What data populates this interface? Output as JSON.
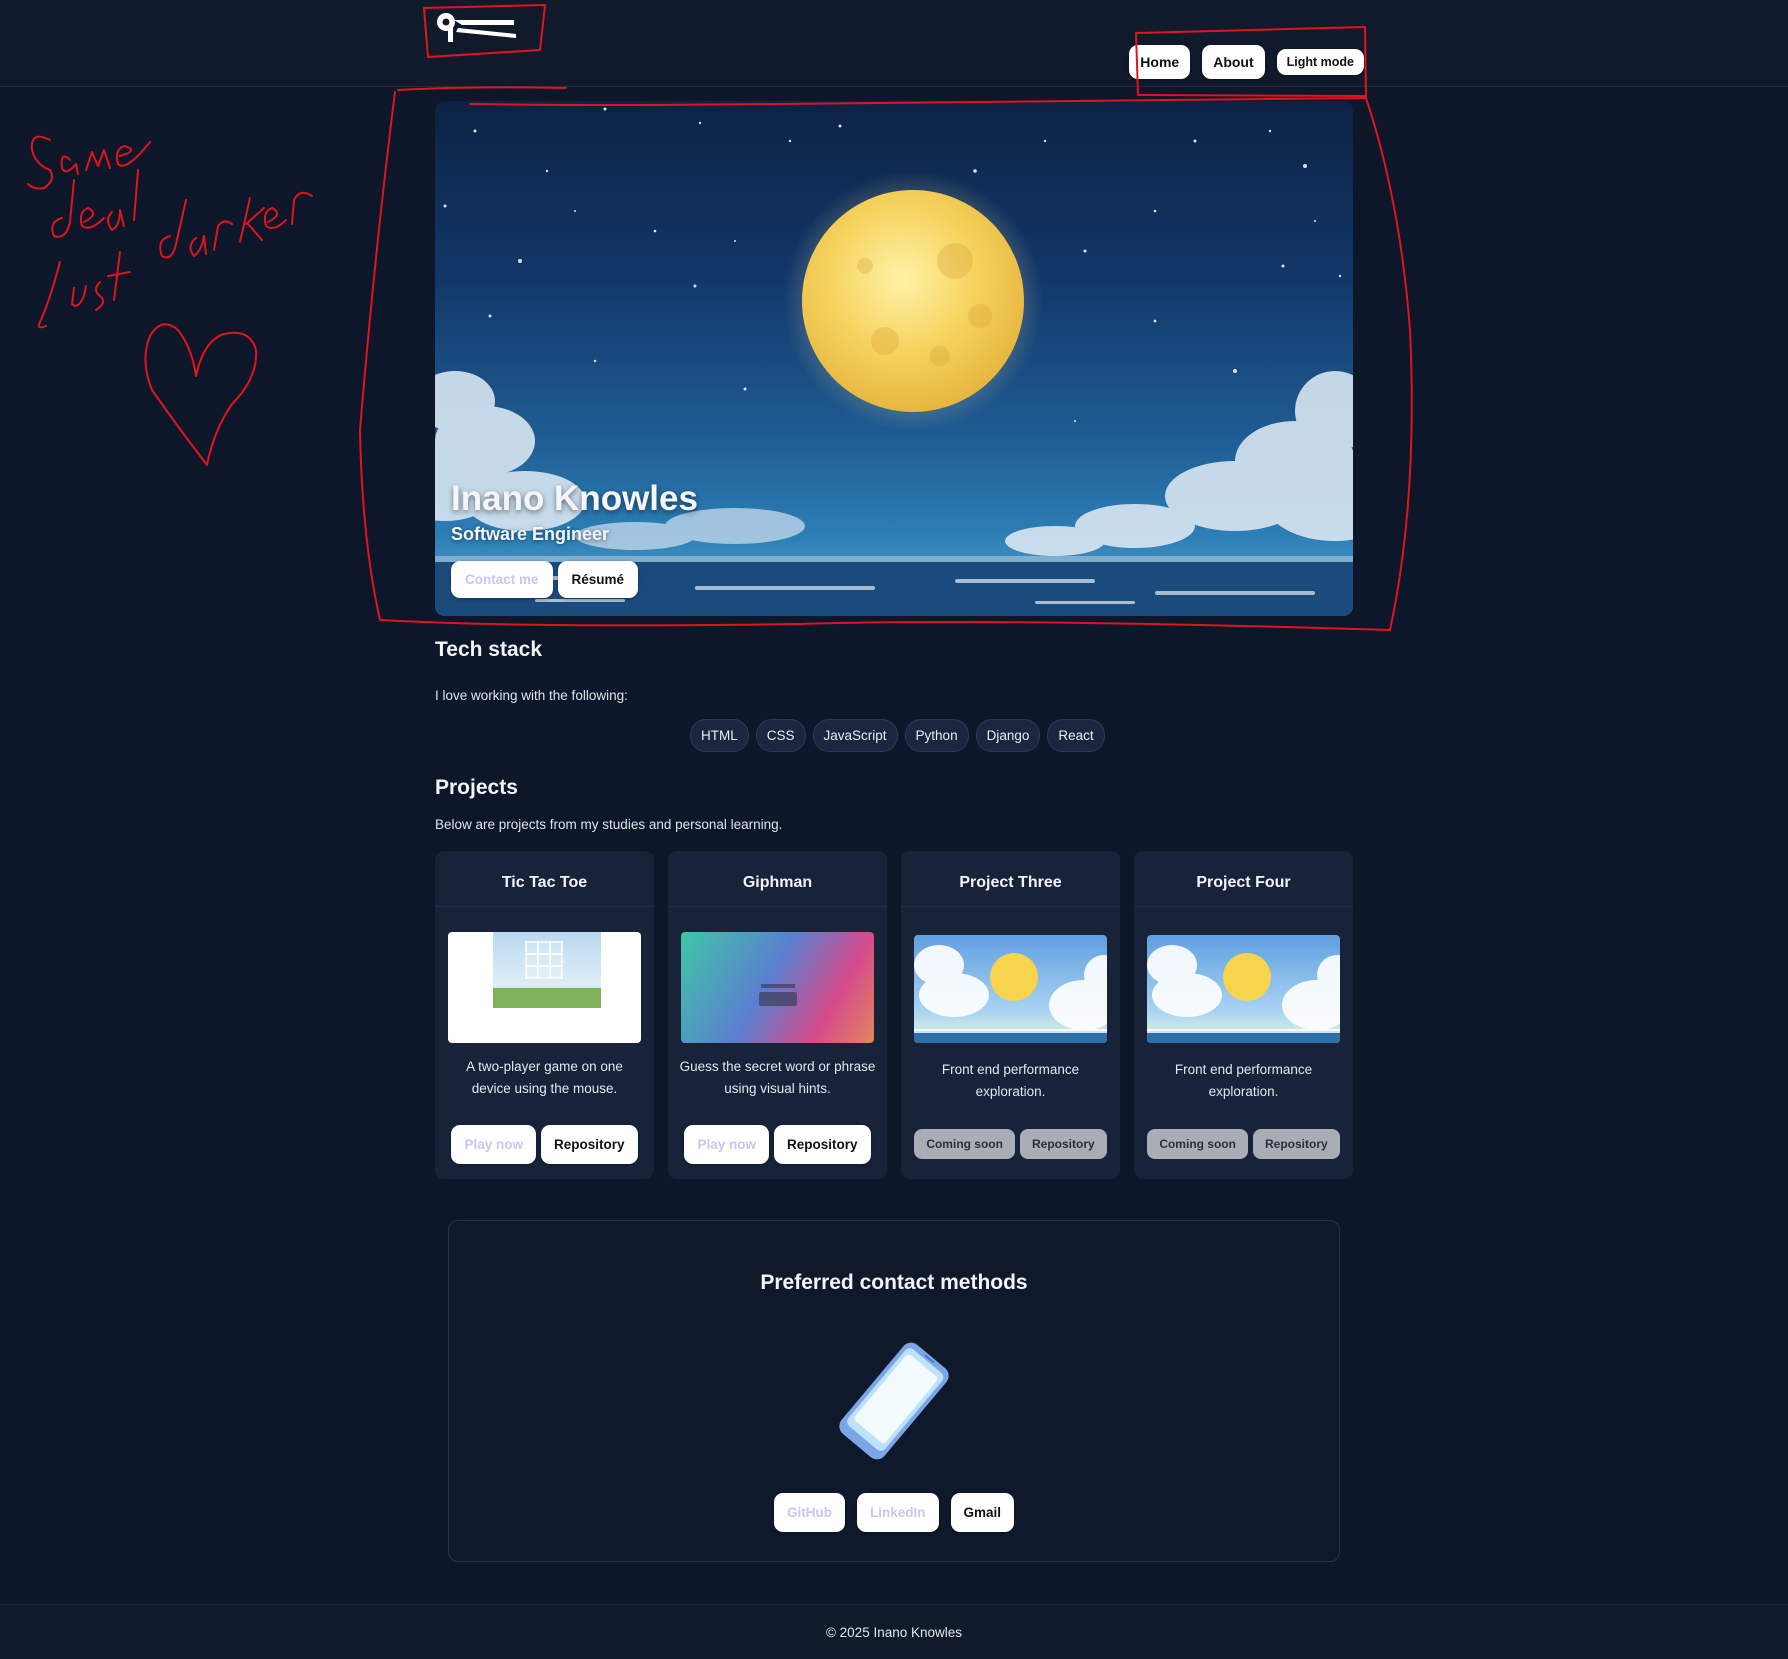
{
  "header": {
    "logo_icon": "ik-monogram-logo",
    "nav": {
      "home_label": "Home",
      "about_label": "About",
      "theme_label": "Light mode"
    }
  },
  "hero": {
    "name": "Inano Knowles",
    "role": "Software Engineer",
    "contact_label": "Contact me",
    "resume_label": "Résumé",
    "background_icon": "full-moon-night-sky-illustration"
  },
  "tech_stack": {
    "title": "Tech stack",
    "intro": "I love working with the following:",
    "items": [
      "HTML",
      "CSS",
      "JavaScript",
      "Python",
      "Django",
      "React"
    ]
  },
  "projects": {
    "title": "Projects",
    "intro": "Below are projects from my studies and personal learning.",
    "items": [
      {
        "title": "Tic Tac Toe",
        "description": "A two-player game on one device using the mouse.",
        "primary_label": "Play now",
        "secondary_label": "Repository",
        "thumb_icon": "tic-tac-toe-screenshot"
      },
      {
        "title": "Giphman",
        "description": "Guess the secret word or phrase using visual hints.",
        "primary_label": "Play now",
        "secondary_label": "Repository",
        "thumb_icon": "giphman-gradient-screenshot"
      },
      {
        "title": "Project Three",
        "description": "Front end performance exploration.",
        "primary_label": "Coming soon",
        "secondary_label": "Repository",
        "thumb_icon": "moon-sky-illustration"
      },
      {
        "title": "Project Four",
        "description": "Front end performance exploration.",
        "primary_label": "Coming soon",
        "secondary_label": "Repository",
        "thumb_icon": "moon-sky-illustration"
      }
    ]
  },
  "contact": {
    "title": "Preferred contact methods",
    "phone_icon": "smartphone-icon",
    "github_label": "GitHub",
    "linkedin_label": "LinkedIn",
    "gmail_label": "Gmail"
  },
  "footer": {
    "copyright": "© 2025 Inano Knowles"
  },
  "annotation": {
    "handwritten_note": "Same deal just darker",
    "heart_icon": "hand-drawn-heart",
    "color": "#e0141e"
  },
  "colors": {
    "page_bg": "#0e1629",
    "card_bg": "#18233a",
    "accent_lavender": "#cfc3f0",
    "button_white": "#ffffff",
    "button_grey": "#a9adb5"
  }
}
